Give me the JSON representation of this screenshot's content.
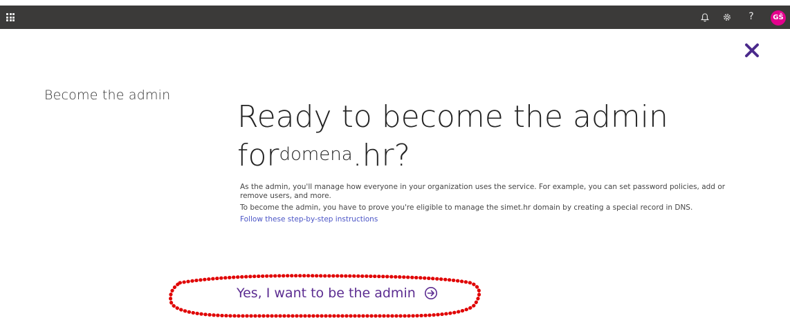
{
  "topbar": {
    "icons": [
      "app-launcher-icon",
      "bell-icon",
      "gear-icon",
      "help-icon"
    ],
    "help_label": "?",
    "avatar_initials": "GŠ",
    "avatar_color": "#e3008c",
    "bar_color": "#3b3a39"
  },
  "close": {
    "icon": "close-icon",
    "color": "#4b2a8c"
  },
  "sidebar": {
    "title": "Become the admin"
  },
  "main": {
    "headline_line1": "Ready to become the admin",
    "headline_for": "for",
    "headline_domain": "domena",
    "headline_suffix": ".hr?",
    "paragraph1": "As the admin, you'll manage how everyone in your organization uses the service. For example, you can set password policies, add or remove users, and more.",
    "paragraph2": "To become the admin, you have to prove you're eligible to manage the simet.hr domain by creating a special record in DNS.",
    "instructions_link": "Follow these step-by-step instructions",
    "link_color": "#4a54c6"
  },
  "action": {
    "admin_button_label": "Yes, I want to be the admin",
    "admin_button_icon": "arrow-right-circle-icon",
    "button_color": "#5c2d91",
    "annotation_color": "#e00000"
  }
}
